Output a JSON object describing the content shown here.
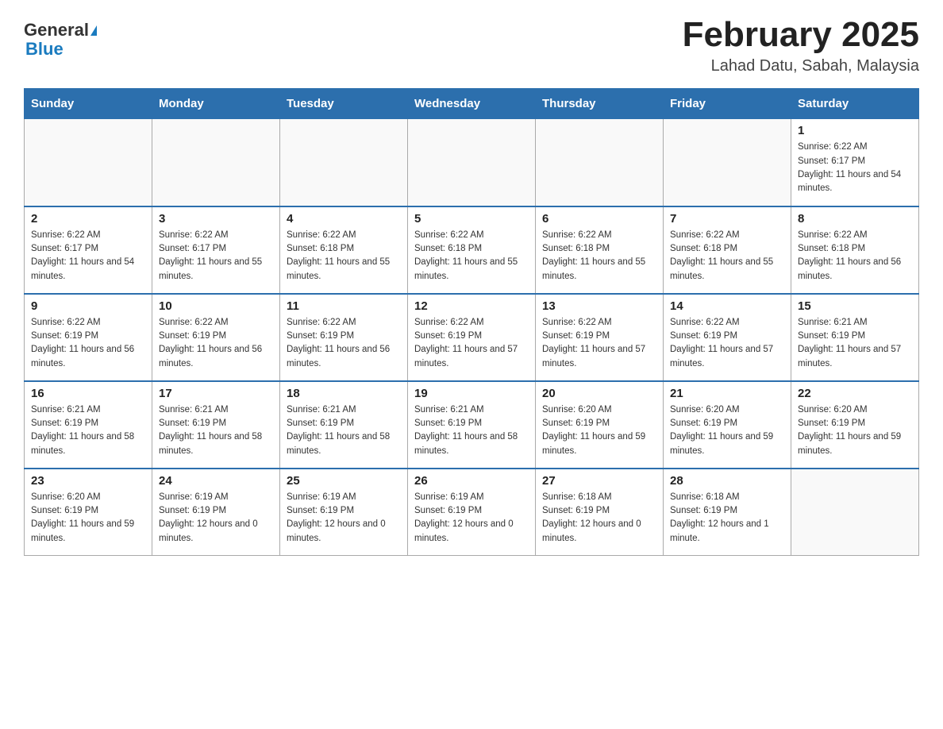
{
  "logo": {
    "text_general": "General",
    "text_blue": "Blue"
  },
  "title": "February 2025",
  "subtitle": "Lahad Datu, Sabah, Malaysia",
  "days_of_week": [
    "Sunday",
    "Monday",
    "Tuesday",
    "Wednesday",
    "Thursday",
    "Friday",
    "Saturday"
  ],
  "weeks": [
    [
      {
        "day": "",
        "sunrise": "",
        "sunset": "",
        "daylight": ""
      },
      {
        "day": "",
        "sunrise": "",
        "sunset": "",
        "daylight": ""
      },
      {
        "day": "",
        "sunrise": "",
        "sunset": "",
        "daylight": ""
      },
      {
        "day": "",
        "sunrise": "",
        "sunset": "",
        "daylight": ""
      },
      {
        "day": "",
        "sunrise": "",
        "sunset": "",
        "daylight": ""
      },
      {
        "day": "",
        "sunrise": "",
        "sunset": "",
        "daylight": ""
      },
      {
        "day": "1",
        "sunrise": "Sunrise: 6:22 AM",
        "sunset": "Sunset: 6:17 PM",
        "daylight": "Daylight: 11 hours and 54 minutes."
      }
    ],
    [
      {
        "day": "2",
        "sunrise": "Sunrise: 6:22 AM",
        "sunset": "Sunset: 6:17 PM",
        "daylight": "Daylight: 11 hours and 54 minutes."
      },
      {
        "day": "3",
        "sunrise": "Sunrise: 6:22 AM",
        "sunset": "Sunset: 6:17 PM",
        "daylight": "Daylight: 11 hours and 55 minutes."
      },
      {
        "day": "4",
        "sunrise": "Sunrise: 6:22 AM",
        "sunset": "Sunset: 6:18 PM",
        "daylight": "Daylight: 11 hours and 55 minutes."
      },
      {
        "day": "5",
        "sunrise": "Sunrise: 6:22 AM",
        "sunset": "Sunset: 6:18 PM",
        "daylight": "Daylight: 11 hours and 55 minutes."
      },
      {
        "day": "6",
        "sunrise": "Sunrise: 6:22 AM",
        "sunset": "Sunset: 6:18 PM",
        "daylight": "Daylight: 11 hours and 55 minutes."
      },
      {
        "day": "7",
        "sunrise": "Sunrise: 6:22 AM",
        "sunset": "Sunset: 6:18 PM",
        "daylight": "Daylight: 11 hours and 55 minutes."
      },
      {
        "day": "8",
        "sunrise": "Sunrise: 6:22 AM",
        "sunset": "Sunset: 6:18 PM",
        "daylight": "Daylight: 11 hours and 56 minutes."
      }
    ],
    [
      {
        "day": "9",
        "sunrise": "Sunrise: 6:22 AM",
        "sunset": "Sunset: 6:19 PM",
        "daylight": "Daylight: 11 hours and 56 minutes."
      },
      {
        "day": "10",
        "sunrise": "Sunrise: 6:22 AM",
        "sunset": "Sunset: 6:19 PM",
        "daylight": "Daylight: 11 hours and 56 minutes."
      },
      {
        "day": "11",
        "sunrise": "Sunrise: 6:22 AM",
        "sunset": "Sunset: 6:19 PM",
        "daylight": "Daylight: 11 hours and 56 minutes."
      },
      {
        "day": "12",
        "sunrise": "Sunrise: 6:22 AM",
        "sunset": "Sunset: 6:19 PM",
        "daylight": "Daylight: 11 hours and 57 minutes."
      },
      {
        "day": "13",
        "sunrise": "Sunrise: 6:22 AM",
        "sunset": "Sunset: 6:19 PM",
        "daylight": "Daylight: 11 hours and 57 minutes."
      },
      {
        "day": "14",
        "sunrise": "Sunrise: 6:22 AM",
        "sunset": "Sunset: 6:19 PM",
        "daylight": "Daylight: 11 hours and 57 minutes."
      },
      {
        "day": "15",
        "sunrise": "Sunrise: 6:21 AM",
        "sunset": "Sunset: 6:19 PM",
        "daylight": "Daylight: 11 hours and 57 minutes."
      }
    ],
    [
      {
        "day": "16",
        "sunrise": "Sunrise: 6:21 AM",
        "sunset": "Sunset: 6:19 PM",
        "daylight": "Daylight: 11 hours and 58 minutes."
      },
      {
        "day": "17",
        "sunrise": "Sunrise: 6:21 AM",
        "sunset": "Sunset: 6:19 PM",
        "daylight": "Daylight: 11 hours and 58 minutes."
      },
      {
        "day": "18",
        "sunrise": "Sunrise: 6:21 AM",
        "sunset": "Sunset: 6:19 PM",
        "daylight": "Daylight: 11 hours and 58 minutes."
      },
      {
        "day": "19",
        "sunrise": "Sunrise: 6:21 AM",
        "sunset": "Sunset: 6:19 PM",
        "daylight": "Daylight: 11 hours and 58 minutes."
      },
      {
        "day": "20",
        "sunrise": "Sunrise: 6:20 AM",
        "sunset": "Sunset: 6:19 PM",
        "daylight": "Daylight: 11 hours and 59 minutes."
      },
      {
        "day": "21",
        "sunrise": "Sunrise: 6:20 AM",
        "sunset": "Sunset: 6:19 PM",
        "daylight": "Daylight: 11 hours and 59 minutes."
      },
      {
        "day": "22",
        "sunrise": "Sunrise: 6:20 AM",
        "sunset": "Sunset: 6:19 PM",
        "daylight": "Daylight: 11 hours and 59 minutes."
      }
    ],
    [
      {
        "day": "23",
        "sunrise": "Sunrise: 6:20 AM",
        "sunset": "Sunset: 6:19 PM",
        "daylight": "Daylight: 11 hours and 59 minutes."
      },
      {
        "day": "24",
        "sunrise": "Sunrise: 6:19 AM",
        "sunset": "Sunset: 6:19 PM",
        "daylight": "Daylight: 12 hours and 0 minutes."
      },
      {
        "day": "25",
        "sunrise": "Sunrise: 6:19 AM",
        "sunset": "Sunset: 6:19 PM",
        "daylight": "Daylight: 12 hours and 0 minutes."
      },
      {
        "day": "26",
        "sunrise": "Sunrise: 6:19 AM",
        "sunset": "Sunset: 6:19 PM",
        "daylight": "Daylight: 12 hours and 0 minutes."
      },
      {
        "day": "27",
        "sunrise": "Sunrise: 6:18 AM",
        "sunset": "Sunset: 6:19 PM",
        "daylight": "Daylight: 12 hours and 0 minutes."
      },
      {
        "day": "28",
        "sunrise": "Sunrise: 6:18 AM",
        "sunset": "Sunset: 6:19 PM",
        "daylight": "Daylight: 12 hours and 1 minute."
      },
      {
        "day": "",
        "sunrise": "",
        "sunset": "",
        "daylight": ""
      }
    ]
  ]
}
